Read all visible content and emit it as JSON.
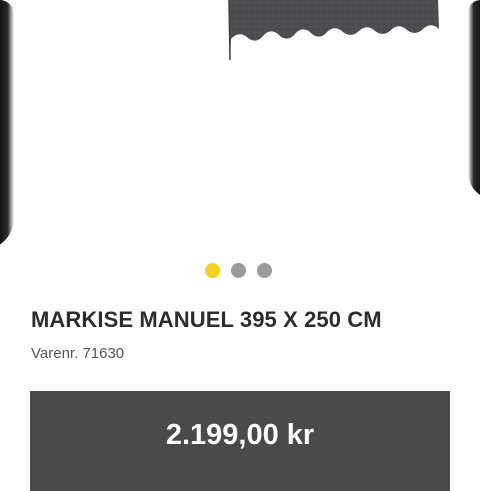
{
  "product": {
    "title": "MARKISE MANUEL 395 X 250 CM",
    "sku_label": "Varenr.",
    "sku": "71630",
    "price": "2.199,00 kr",
    "awning_color": "#4b4b4d"
  },
  "carousel": {
    "image_count": 3,
    "active_index": 0,
    "active_color": "#f2d21d",
    "inactive_color": "#9b9b9b"
  }
}
